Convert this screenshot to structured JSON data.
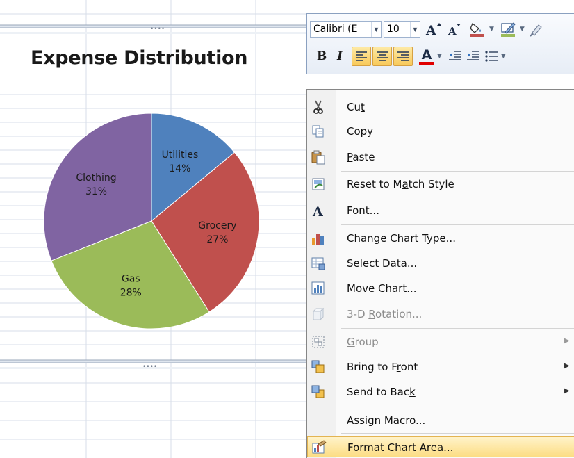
{
  "chart": {
    "title": "Expense Distribution"
  },
  "chart_data": {
    "type": "pie",
    "title": "Expense Distribution",
    "categories": [
      "Utilities",
      "Grocery",
      "Gas",
      "Clothing"
    ],
    "values": [
      14,
      27,
      28,
      31
    ],
    "labels": [
      "14%",
      "27%",
      "28%",
      "31%"
    ],
    "colors": [
      "#4f81bd",
      "#c0504d",
      "#9bbb59",
      "#8064a2"
    ],
    "legend": "none",
    "data_labels": "category and percentage inside slices"
  },
  "toolbar": {
    "font_name": "Calibri (E",
    "font_size": "10",
    "grow_font_icon": "grow-font-icon",
    "shrink_font_icon": "shrink-font-icon",
    "fill_color_icon": "fill-color-icon",
    "outline_color_icon": "outline-color-icon",
    "format_painter_icon": "format-painter-icon",
    "bold_label": "B",
    "italic_label": "I",
    "font_color_label": "A",
    "fill_color": "#c0504d",
    "outline_color": "#9bbb59",
    "font_color": "#e00000"
  },
  "menu": {
    "items": [
      {
        "label": "Cut",
        "mnemonic": "t",
        "icon": "scissors-icon",
        "enabled": true
      },
      {
        "label": "Copy",
        "mnemonic": "C",
        "icon": "copy-icon",
        "enabled": true
      },
      {
        "label": "Paste",
        "mnemonic": "P",
        "icon": "paste-icon",
        "enabled": true
      },
      {
        "label": "Reset to Match Style",
        "mnemonic": "a",
        "icon": "reset-style-icon",
        "enabled": true
      },
      {
        "label": "Font...",
        "mnemonic": "F",
        "icon": "font-icon",
        "enabled": true
      },
      {
        "label": "Change Chart Type...",
        "mnemonic": "Y",
        "icon": "chart-type-icon",
        "enabled": true
      },
      {
        "label": "Select Data...",
        "mnemonic": "e",
        "icon": "select-data-icon",
        "enabled": true
      },
      {
        "label": "Move Chart...",
        "mnemonic": "v",
        "icon": "move-chart-icon",
        "enabled": true
      },
      {
        "label": "3-D Rotation...",
        "mnemonic": "R",
        "icon": "rotation-3d-icon",
        "enabled": false
      },
      {
        "label": "Group",
        "mnemonic": "G",
        "icon": "group-icon",
        "enabled": false
      },
      {
        "label": "Bring to Front",
        "mnemonic": "r",
        "icon": "bring-to-front-icon",
        "enabled": true
      },
      {
        "label": "Send to Back",
        "mnemonic": "k",
        "icon": "send-to-back-icon",
        "enabled": true
      },
      {
        "label": "Assign Macro...",
        "mnemonic": "n",
        "icon": "",
        "enabled": true
      },
      {
        "label": "Format Chart Area...",
        "mnemonic": "F",
        "icon": "format-chart-area-icon",
        "enabled": true,
        "highlighted": true
      }
    ]
  }
}
